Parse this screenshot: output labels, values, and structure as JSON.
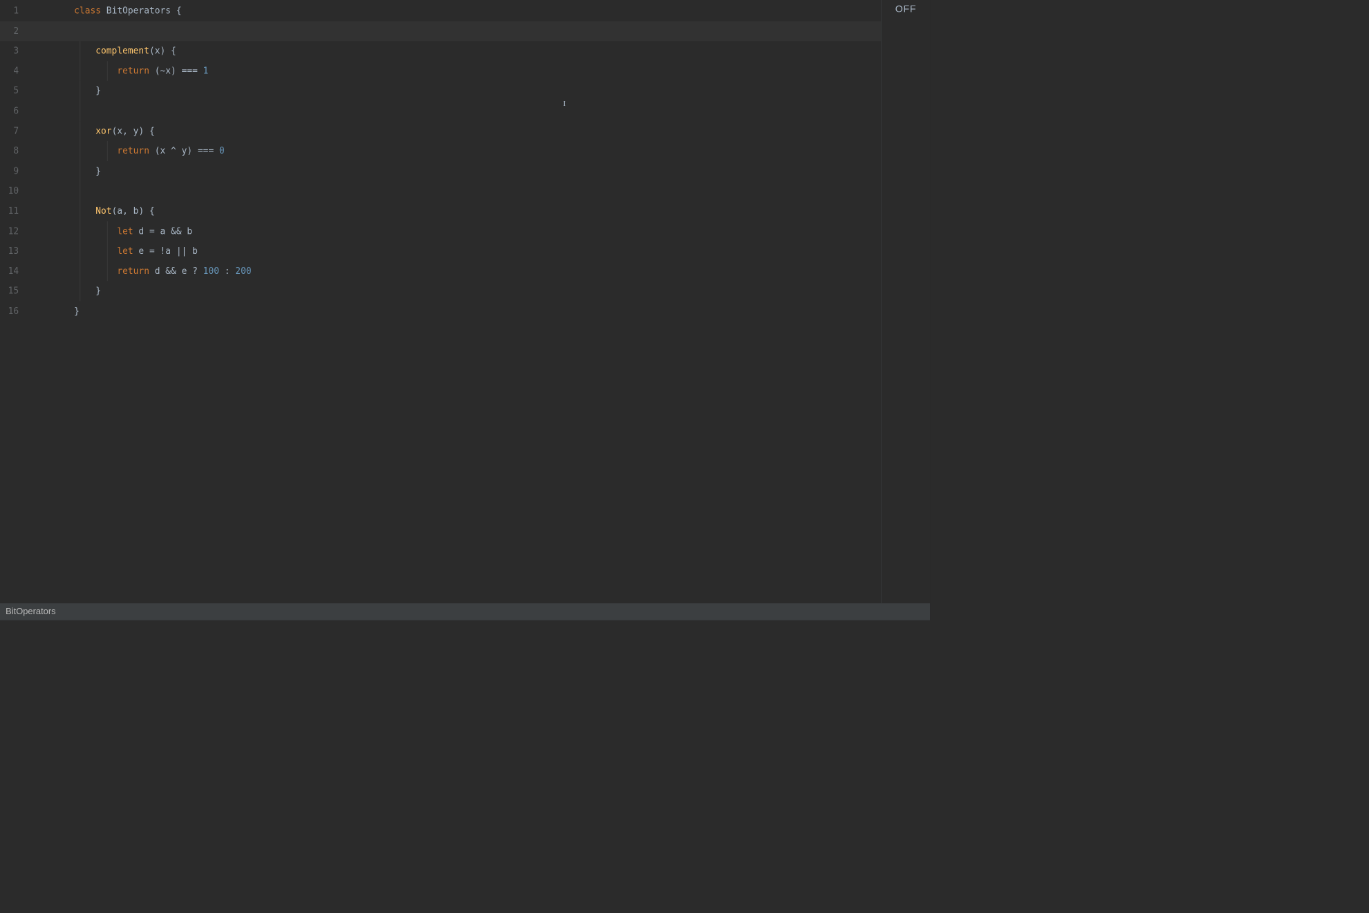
{
  "rightPanel": {
    "toggle": "OFF"
  },
  "statusBar": {
    "context": "BitOperators"
  },
  "lineNumbers": [
    "1",
    "2",
    "3",
    "4",
    "5",
    "6",
    "7",
    "8",
    "9",
    "10",
    "11",
    "12",
    "13",
    "14",
    "15",
    "16"
  ],
  "code": {
    "highlightedLine": 2,
    "lines": [
      {
        "indent": 1,
        "tokens": [
          {
            "t": "class ",
            "c": "kw"
          },
          {
            "t": "BitOperators ",
            "c": "cls"
          },
          {
            "t": "{",
            "c": "punct"
          }
        ]
      },
      {
        "indent": 0,
        "tokens": []
      },
      {
        "indent": 2,
        "tokens": [
          {
            "t": "complement",
            "c": "fn"
          },
          {
            "t": "(",
            "c": "punct"
          },
          {
            "t": "x",
            "c": "ident"
          },
          {
            "t": ") {",
            "c": "punct"
          }
        ]
      },
      {
        "indent": 3,
        "tokens": [
          {
            "t": "return ",
            "c": "kw"
          },
          {
            "t": "(~x) === ",
            "c": "op"
          },
          {
            "t": "1",
            "c": "num"
          }
        ]
      },
      {
        "indent": 2,
        "tokens": [
          {
            "t": "}",
            "c": "punct"
          }
        ]
      },
      {
        "indent": 0,
        "tokens": []
      },
      {
        "indent": 2,
        "tokens": [
          {
            "t": "xor",
            "c": "fn"
          },
          {
            "t": "(",
            "c": "punct"
          },
          {
            "t": "x",
            "c": "ident"
          },
          {
            "t": ", ",
            "c": "punct"
          },
          {
            "t": "y",
            "c": "ident"
          },
          {
            "t": ") {",
            "c": "punct"
          }
        ]
      },
      {
        "indent": 3,
        "tokens": [
          {
            "t": "return ",
            "c": "kw"
          },
          {
            "t": "(x ^ y) === ",
            "c": "op"
          },
          {
            "t": "0",
            "c": "num"
          }
        ]
      },
      {
        "indent": 2,
        "tokens": [
          {
            "t": "}",
            "c": "punct"
          }
        ]
      },
      {
        "indent": 0,
        "tokens": []
      },
      {
        "indent": 2,
        "tokens": [
          {
            "t": "Not",
            "c": "fn"
          },
          {
            "t": "(",
            "c": "punct"
          },
          {
            "t": "a",
            "c": "ident"
          },
          {
            "t": ", ",
            "c": "punct"
          },
          {
            "t": "b",
            "c": "ident"
          },
          {
            "t": ") {",
            "c": "punct"
          }
        ]
      },
      {
        "indent": 3,
        "tokens": [
          {
            "t": "let ",
            "c": "kw"
          },
          {
            "t": "d = a && b",
            "c": "op"
          }
        ]
      },
      {
        "indent": 3,
        "tokens": [
          {
            "t": "let ",
            "c": "kw"
          },
          {
            "t": "e = !a || b",
            "c": "op"
          }
        ]
      },
      {
        "indent": 3,
        "tokens": [
          {
            "t": "return ",
            "c": "kw"
          },
          {
            "t": "d && e ? ",
            "c": "op"
          },
          {
            "t": "100",
            "c": "num"
          },
          {
            "t": " : ",
            "c": "op"
          },
          {
            "t": "200",
            "c": "num"
          }
        ]
      },
      {
        "indent": 2,
        "tokens": [
          {
            "t": "}",
            "c": "punct"
          }
        ]
      },
      {
        "indent": 1,
        "tokens": [
          {
            "t": "}",
            "c": "punct"
          }
        ]
      }
    ]
  },
  "cursor": {
    "glyph": "I"
  }
}
